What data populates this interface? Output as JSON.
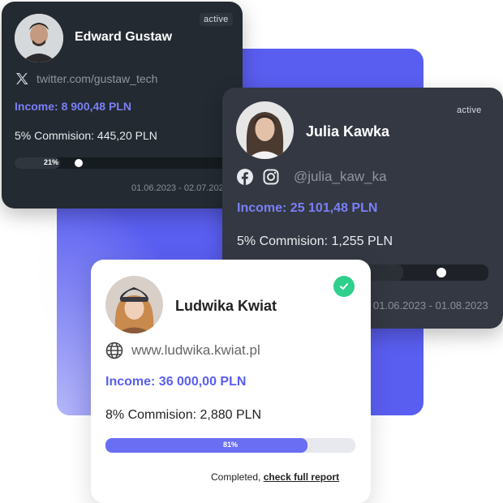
{
  "cards": [
    {
      "name": "Edward Gustaw",
      "status": "active",
      "social_handle": "twitter.com/gustaw_tech",
      "social_icons": [
        "x-twitter-icon"
      ],
      "income": "Income: 8 900,48 PLN",
      "commission": "5% Commision: 445,20 PLN",
      "progress_label": "21%",
      "progress": 0.21,
      "date_range": "01.06.2023 - 02.07.2023"
    },
    {
      "name": "Julia Kawka",
      "status": "active",
      "social_handle": "@julia_kaw_ka",
      "social_icons": [
        "facebook-icon",
        "instagram-icon"
      ],
      "income": "Income: 25 101,48 PLN",
      "commission": "5% Commision: 1,255 PLN",
      "progress": 0.66,
      "date_range": "01.06.2023 - 01.08.2023"
    },
    {
      "name": "Ludwika Kwiat",
      "status_icon": "check-icon",
      "website": "www.ludwika.kwiat.pl",
      "income": "Income: 36 000,00 PLN",
      "commission": "8% Commision: 2,880 PLN",
      "progress_label": "81%",
      "progress": 0.81,
      "completed_text": "Completed,",
      "report_link": "check full report"
    }
  ],
  "colors": {
    "accent": "#7b7ff7",
    "panel_blue": "#5a5ef0",
    "success": "#2ed08c",
    "dark_card_1": "#232a31",
    "dark_card_2": "#333842"
  }
}
